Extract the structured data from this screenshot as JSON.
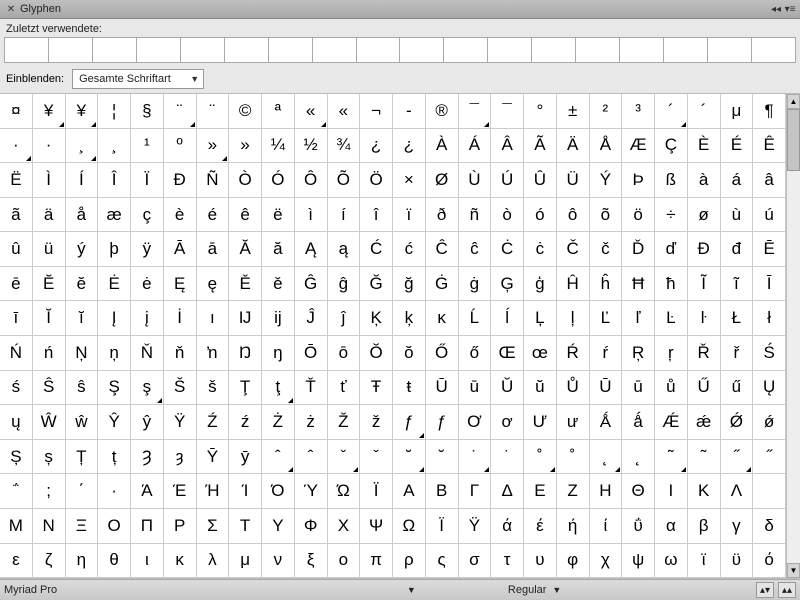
{
  "window": {
    "title": "Glyphen"
  },
  "recent": {
    "label": "Zuletzt verwendete:"
  },
  "showbar": {
    "label": "Einblenden:",
    "dropdown_value": "Gesamte Schriftart"
  },
  "statusbar": {
    "font_name": "Myriad Pro",
    "style": "Regular"
  },
  "chart_data": {
    "type": "table",
    "title": "Glyph grid",
    "cols": 24,
    "rows": 17,
    "rows_data": [
      [
        {
          "c": "¤"
        },
        {
          "c": "¥",
          "t": 1
        },
        {
          "c": "¥",
          "t": 1
        },
        {
          "c": "¦"
        },
        {
          "c": "§"
        },
        {
          "c": "¨",
          "t": 1
        },
        {
          "c": "¨"
        },
        {
          "c": "©"
        },
        {
          "c": "ª"
        },
        {
          "c": "«",
          "t": 1
        },
        {
          "c": "«"
        },
        {
          "c": "¬"
        },
        {
          "c": "-"
        },
        {
          "c": "®"
        },
        {
          "c": "¯",
          "t": 1
        },
        {
          "c": "¯"
        },
        {
          "c": "°"
        },
        {
          "c": "±"
        },
        {
          "c": "²"
        },
        {
          "c": "³"
        },
        {
          "c": "´",
          "t": 1
        },
        {
          "c": "´"
        },
        {
          "c": "μ"
        },
        {
          "c": "¶"
        }
      ],
      [
        {
          "c": "·",
          "t": 1
        },
        {
          "c": "·"
        },
        {
          "c": "¸",
          "t": 1
        },
        {
          "c": "¸"
        },
        {
          "c": "¹"
        },
        {
          "c": "º"
        },
        {
          "c": "»",
          "t": 1
        },
        {
          "c": "»"
        },
        {
          "c": "¼"
        },
        {
          "c": "½"
        },
        {
          "c": "¾"
        },
        {
          "c": "¿"
        },
        {
          "c": "¿"
        },
        {
          "c": "À"
        },
        {
          "c": "Á"
        },
        {
          "c": "Â"
        },
        {
          "c": "Ã"
        },
        {
          "c": "Ä"
        },
        {
          "c": "Å"
        },
        {
          "c": "Æ"
        },
        {
          "c": "Ç"
        },
        {
          "c": "È"
        },
        {
          "c": "É"
        },
        {
          "c": "Ê"
        }
      ],
      [
        {
          "c": "Ë"
        },
        {
          "c": "Ì"
        },
        {
          "c": "Í"
        },
        {
          "c": "Î"
        },
        {
          "c": "Ï"
        },
        {
          "c": "Ð"
        },
        {
          "c": "Ñ"
        },
        {
          "c": "Ò"
        },
        {
          "c": "Ó"
        },
        {
          "c": "Ô"
        },
        {
          "c": "Õ"
        },
        {
          "c": "Ö"
        },
        {
          "c": "×"
        },
        {
          "c": "Ø"
        },
        {
          "c": "Ù"
        },
        {
          "c": "Ú"
        },
        {
          "c": "Û"
        },
        {
          "c": "Ü"
        },
        {
          "c": "Ý"
        },
        {
          "c": "Þ"
        },
        {
          "c": "ß"
        },
        {
          "c": "à"
        },
        {
          "c": "á"
        },
        {
          "c": "â"
        }
      ],
      [
        {
          "c": "ã"
        },
        {
          "c": "ä"
        },
        {
          "c": "å"
        },
        {
          "c": "æ"
        },
        {
          "c": "ç"
        },
        {
          "c": "è"
        },
        {
          "c": "é"
        },
        {
          "c": "ê"
        },
        {
          "c": "ë"
        },
        {
          "c": "ì"
        },
        {
          "c": "í"
        },
        {
          "c": "î"
        },
        {
          "c": "ï"
        },
        {
          "c": "ð"
        },
        {
          "c": "ñ"
        },
        {
          "c": "ò"
        },
        {
          "c": "ó"
        },
        {
          "c": "ô"
        },
        {
          "c": "õ"
        },
        {
          "c": "ö"
        },
        {
          "c": "÷"
        },
        {
          "c": "ø"
        },
        {
          "c": "ù"
        },
        {
          "c": "ú"
        }
      ],
      [
        {
          "c": "û"
        },
        {
          "c": "ü"
        },
        {
          "c": "ý"
        },
        {
          "c": "þ"
        },
        {
          "c": "ÿ"
        },
        {
          "c": "Ā"
        },
        {
          "c": "ā"
        },
        {
          "c": "Ă"
        },
        {
          "c": "ă"
        },
        {
          "c": "Ą"
        },
        {
          "c": "ą"
        },
        {
          "c": "Ć"
        },
        {
          "c": "ć"
        },
        {
          "c": "Ĉ"
        },
        {
          "c": "ĉ"
        },
        {
          "c": "Ċ"
        },
        {
          "c": "ċ"
        },
        {
          "c": "Č"
        },
        {
          "c": "č"
        },
        {
          "c": "Ď"
        },
        {
          "c": "ď"
        },
        {
          "c": "Đ"
        },
        {
          "c": "đ"
        },
        {
          "c": "Ē"
        }
      ],
      [
        {
          "c": "ē"
        },
        {
          "c": "Ĕ"
        },
        {
          "c": "ĕ"
        },
        {
          "c": "Ė"
        },
        {
          "c": "ė"
        },
        {
          "c": "Ę"
        },
        {
          "c": "ę"
        },
        {
          "c": "Ě"
        },
        {
          "c": "ě"
        },
        {
          "c": "Ĝ"
        },
        {
          "c": "ĝ"
        },
        {
          "c": "Ğ"
        },
        {
          "c": "ğ"
        },
        {
          "c": "Ġ"
        },
        {
          "c": "ġ"
        },
        {
          "c": "Ģ"
        },
        {
          "c": "ģ"
        },
        {
          "c": "Ĥ"
        },
        {
          "c": "ĥ"
        },
        {
          "c": "Ħ"
        },
        {
          "c": "ħ"
        },
        {
          "c": "Ĩ"
        },
        {
          "c": "ĩ"
        },
        {
          "c": "Ī"
        }
      ],
      [
        {
          "c": "ī"
        },
        {
          "c": "Ĭ"
        },
        {
          "c": "ĭ"
        },
        {
          "c": "Į"
        },
        {
          "c": "į"
        },
        {
          "c": "İ"
        },
        {
          "c": "ı"
        },
        {
          "c": "Ĳ"
        },
        {
          "c": "ĳ"
        },
        {
          "c": "Ĵ"
        },
        {
          "c": "ĵ"
        },
        {
          "c": "Ķ"
        },
        {
          "c": "ķ"
        },
        {
          "c": "ĸ"
        },
        {
          "c": "Ĺ"
        },
        {
          "c": "ĺ"
        },
        {
          "c": "Ļ"
        },
        {
          "c": "ļ"
        },
        {
          "c": "Ľ"
        },
        {
          "c": "ľ"
        },
        {
          "c": "Ŀ"
        },
        {
          "c": "ŀ"
        },
        {
          "c": "Ł"
        },
        {
          "c": "ł"
        }
      ],
      [
        {
          "c": "Ń"
        },
        {
          "c": "ń"
        },
        {
          "c": "Ņ"
        },
        {
          "c": "ņ"
        },
        {
          "c": "Ň"
        },
        {
          "c": "ň"
        },
        {
          "c": "ŉ"
        },
        {
          "c": "Ŋ"
        },
        {
          "c": "ŋ"
        },
        {
          "c": "Ō"
        },
        {
          "c": "ō"
        },
        {
          "c": "Ŏ"
        },
        {
          "c": "ŏ"
        },
        {
          "c": "Ő"
        },
        {
          "c": "ő"
        },
        {
          "c": "Œ"
        },
        {
          "c": "œ"
        },
        {
          "c": "Ŕ"
        },
        {
          "c": "ŕ"
        },
        {
          "c": "Ŗ"
        },
        {
          "c": "ŗ"
        },
        {
          "c": "Ř"
        },
        {
          "c": "ř"
        },
        {
          "c": "Ś"
        }
      ],
      [
        {
          "c": "ś"
        },
        {
          "c": "Ŝ"
        },
        {
          "c": "ŝ"
        },
        {
          "c": "Ş"
        },
        {
          "c": "ş",
          "t": 1
        },
        {
          "c": "Š"
        },
        {
          "c": "š"
        },
        {
          "c": "Ţ"
        },
        {
          "c": "ţ",
          "t": 1
        },
        {
          "c": "Ť"
        },
        {
          "c": "ť"
        },
        {
          "c": "Ŧ"
        },
        {
          "c": "ŧ"
        },
        {
          "c": "Ū"
        },
        {
          "c": "ū"
        },
        {
          "c": "Ŭ"
        },
        {
          "c": "ŭ"
        },
        {
          "c": "Ů"
        },
        {
          "c": "Ū"
        },
        {
          "c": "ū"
        },
        {
          "c": "ů"
        },
        {
          "c": "Ű"
        },
        {
          "c": "ű"
        },
        {
          "c": "Ų"
        }
      ],
      [
        {
          "c": "ų"
        },
        {
          "c": "Ŵ"
        },
        {
          "c": "ŵ"
        },
        {
          "c": "Ŷ"
        },
        {
          "c": "ŷ"
        },
        {
          "c": "Ÿ"
        },
        {
          "c": "Ź"
        },
        {
          "c": "ź"
        },
        {
          "c": "Ż"
        },
        {
          "c": "ż"
        },
        {
          "c": "Ž"
        },
        {
          "c": "ž"
        },
        {
          "c": "ƒ",
          "t": 1
        },
        {
          "c": "ƒ"
        },
        {
          "c": "Ơ"
        },
        {
          "c": "ơ"
        },
        {
          "c": "Ư"
        },
        {
          "c": "ư"
        },
        {
          "c": "Ǻ"
        },
        {
          "c": "ǻ"
        },
        {
          "c": "Ǽ"
        },
        {
          "c": "ǽ"
        },
        {
          "c": "Ǿ"
        },
        {
          "c": "ǿ"
        }
      ],
      [
        {
          "c": "Ș"
        },
        {
          "c": "ș"
        },
        {
          "c": "Ț"
        },
        {
          "c": "ț"
        },
        {
          "c": "Ȝ"
        },
        {
          "c": "ȝ"
        },
        {
          "c": "Ȳ"
        },
        {
          "c": "ȳ"
        },
        {
          "c": "ˆ",
          "t": 1
        },
        {
          "c": "ˆ"
        },
        {
          "c": "ˇ",
          "t": 1
        },
        {
          "c": "ˇ"
        },
        {
          "c": "˘",
          "t": 1
        },
        {
          "c": "˘"
        },
        {
          "c": "˙",
          "t": 1
        },
        {
          "c": "˙"
        },
        {
          "c": "˚",
          "t": 1
        },
        {
          "c": "˚"
        },
        {
          "c": "˛",
          "t": 1
        },
        {
          "c": "˛"
        },
        {
          "c": "˜",
          "t": 1
        },
        {
          "c": "˜"
        },
        {
          "c": "˝",
          "t": 1
        },
        {
          "c": "˝"
        }
      ],
      [
        {
          "c": "΅"
        },
        {
          "c": ";"
        },
        {
          "c": "΄"
        },
        {
          "c": "·"
        },
        {
          "c": "Ά"
        },
        {
          "c": "Έ"
        },
        {
          "c": "Ή"
        },
        {
          "c": "Ί"
        },
        {
          "c": "Ό"
        },
        {
          "c": "Ύ"
        },
        {
          "c": "Ώ"
        },
        {
          "c": "Ϊ"
        },
        {
          "c": "Α"
        },
        {
          "c": "Β"
        },
        {
          "c": "Γ"
        },
        {
          "c": "Δ"
        },
        {
          "c": "Ε"
        },
        {
          "c": "Ζ"
        },
        {
          "c": "Η"
        },
        {
          "c": "Θ"
        },
        {
          "c": "Ι"
        },
        {
          "c": "Κ"
        },
        {
          "c": "Λ"
        }
      ],
      [
        {
          "c": "Μ"
        },
        {
          "c": "Ν"
        },
        {
          "c": "Ξ"
        },
        {
          "c": "Ο"
        },
        {
          "c": "Π"
        },
        {
          "c": "Ρ"
        },
        {
          "c": "Σ"
        },
        {
          "c": "Τ"
        },
        {
          "c": "Υ"
        },
        {
          "c": "Φ"
        },
        {
          "c": "Χ"
        },
        {
          "c": "Ψ"
        },
        {
          "c": "Ω"
        },
        {
          "c": "Ϊ"
        },
        {
          "c": "Ϋ"
        },
        {
          "c": "ά"
        },
        {
          "c": "έ"
        },
        {
          "c": "ή"
        },
        {
          "c": "ί"
        },
        {
          "c": "ΰ"
        },
        {
          "c": "α"
        },
        {
          "c": "β"
        },
        {
          "c": "γ"
        },
        {
          "c": "δ"
        }
      ],
      [
        {
          "c": "ε"
        },
        {
          "c": "ζ"
        },
        {
          "c": "η"
        },
        {
          "c": "θ"
        },
        {
          "c": "ι"
        },
        {
          "c": "κ"
        },
        {
          "c": "λ"
        },
        {
          "c": "μ"
        },
        {
          "c": "ν"
        },
        {
          "c": "ξ"
        },
        {
          "c": "ο"
        },
        {
          "c": "π"
        },
        {
          "c": "ρ"
        },
        {
          "c": "ς"
        },
        {
          "c": "σ"
        },
        {
          "c": "τ"
        },
        {
          "c": "υ"
        },
        {
          "c": "φ"
        },
        {
          "c": "χ"
        },
        {
          "c": "ψ"
        },
        {
          "c": "ω"
        },
        {
          "c": "ϊ"
        },
        {
          "c": "ϋ"
        },
        {
          "c": "ό"
        }
      ]
    ]
  }
}
